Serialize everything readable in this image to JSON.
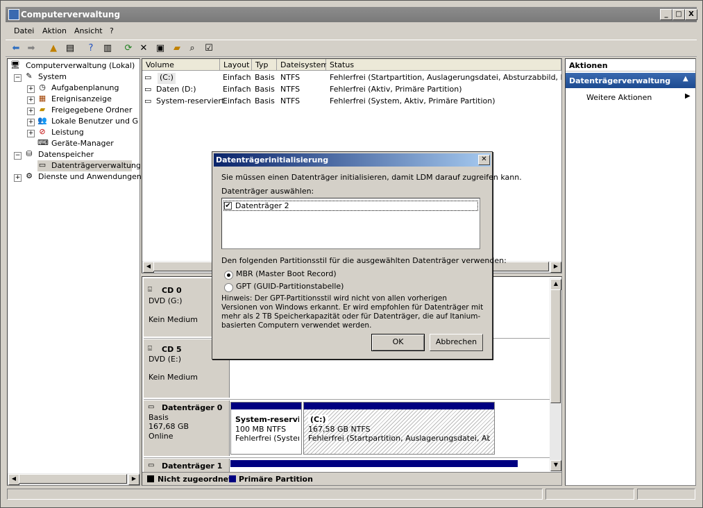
{
  "window": {
    "title": "Computerverwaltung",
    "controls": [
      "_",
      "□",
      "X"
    ]
  },
  "menu": [
    "Datei",
    "Aktion",
    "Ansicht",
    "?"
  ],
  "tree": {
    "root": "Computerverwaltung (Lokal)",
    "system": "System",
    "system_items": [
      "Aufgabenplanung",
      "Ereignisanzeige",
      "Freigegebene Ordner",
      "Lokale Benutzer und Gruppen",
      "Leistung",
      "Geräte-Manager"
    ],
    "storage": "Datenspeicher",
    "storage_items": [
      "Datenträgerverwaltung"
    ],
    "services": "Dienste und Anwendungen"
  },
  "volumes": {
    "headers": [
      "Volume",
      "Layout",
      "Typ",
      "Dateisystem",
      "Status"
    ],
    "rows": [
      {
        "volume": "(C:)",
        "layout": "Einfach",
        "type": "Basis",
        "fs": "NTFS",
        "status": "Fehlerfrei (Startpartition, Auslagerungsdatei, Absturzabbild, Primäre Partition)"
      },
      {
        "volume": "Daten (D:)",
        "layout": "Einfach",
        "type": "Basis",
        "fs": "NTFS",
        "status": "Fehlerfrei (Aktiv, Primäre Partition)"
      },
      {
        "volume": "System-reserviert",
        "layout": "Einfach",
        "type": "Basis",
        "fs": "NTFS",
        "status": "Fehlerfrei (System, Aktiv, Primäre Partition)"
      }
    ]
  },
  "disks": {
    "cd0": {
      "name": "CD 0",
      "drive": "DVD (G:)",
      "media": "Kein Medium"
    },
    "cd5": {
      "name": "CD 5",
      "drive": "DVD (E:)",
      "media": "Kein Medium"
    },
    "disk0": {
      "name": "Datenträger 0",
      "type": "Basis",
      "size": "167,68 GB",
      "state": "Online",
      "p1": {
        "name": "System-reservi",
        "size": "100 MB NTFS",
        "status": "Fehlerfrei (System,"
      },
      "p2": {
        "name": "(C:)",
        "size": "167,58 GB NTFS",
        "status": "Fehlerfrei (Startpartition, Auslagerungsdatei, Absturza"
      }
    },
    "disk1": {
      "name": "Datenträger 1"
    }
  },
  "legend": {
    "unallocated": "Nicht zugeordnet",
    "primary": "Primäre Partition"
  },
  "actions": {
    "header": "Aktionen",
    "section": "Datenträgerverwaltung",
    "more": "Weitere Aktionen"
  },
  "dialog": {
    "title": "Datenträgerinitialisierung",
    "intro": "Sie müssen einen Datenträger initialisieren, damit LDM darauf zugreifen kann.",
    "select_label": "Datenträger auswählen:",
    "disk_item": "Datenträger 2",
    "style_label": "Den folgenden Partitionsstil für die ausgewählten Datenträger verwenden:",
    "mbr": "MBR (Master Boot Record)",
    "gpt": "GPT (GUID-Partitionstabelle)",
    "hint": "Hinweis: Der GPT-Partitionsstil wird nicht von allen vorherigen Versionen von Windows erkannt. Er wird empfohlen für Datenträger mit mehr als 2 TB Speicherkapazität oder für Datenträger, die auf Itanium-basierten Computern verwendet werden.",
    "ok": "OK",
    "cancel": "Abbrechen"
  },
  "colors": {
    "primary": "#000080",
    "unallocated": "#000000",
    "title_active": "#0a246a"
  }
}
